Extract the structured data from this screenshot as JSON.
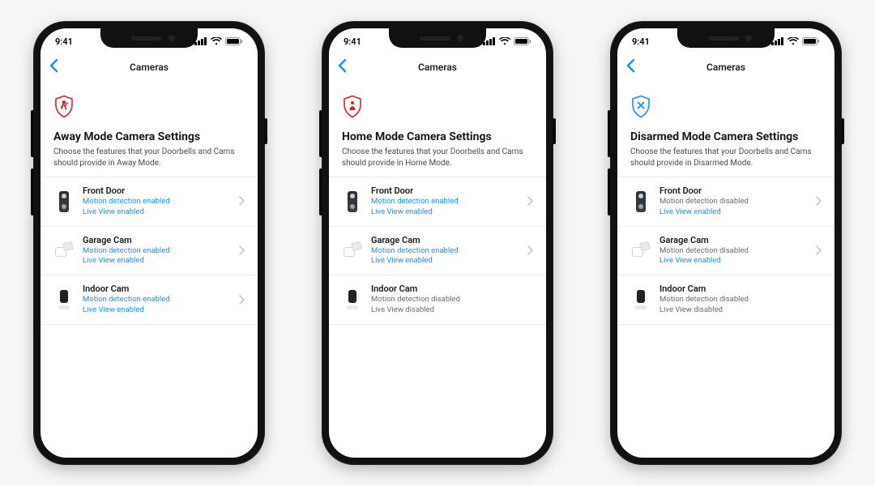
{
  "status": {
    "time": "9:41"
  },
  "nav": {
    "title": "Cameras"
  },
  "screens": [
    {
      "mode": "away",
      "title": "Away Mode Camera Settings",
      "subtitle": "Choose the features that your Doorbells and Cams should provide in Away Mode.",
      "devices": [
        {
          "name": "Front Door",
          "thumb": "doorbell",
          "motion": "Motion detection enabled",
          "motion_state": "enabled",
          "live": "Live View enabled",
          "live_state": "enabled",
          "chevron": true
        },
        {
          "name": "Garage Cam",
          "thumb": "spotlight",
          "motion": "Motion detection enabled",
          "motion_state": "enabled",
          "live": "Live View enabled",
          "live_state": "enabled",
          "chevron": true
        },
        {
          "name": "Indoor Cam",
          "thumb": "indoor",
          "motion": "Motion detection enabled",
          "motion_state": "enabled",
          "live": "Live View enabled",
          "live_state": "enabled",
          "chevron": true
        }
      ]
    },
    {
      "mode": "home",
      "title": "Home Mode Camera Settings",
      "subtitle": "Choose the features that your Doorbells and Cams should provide in Home Mode.",
      "devices": [
        {
          "name": "Front Door",
          "thumb": "doorbell",
          "motion": "Motion detection enabled",
          "motion_state": "enabled",
          "live": "Live View enabled",
          "live_state": "enabled",
          "chevron": true
        },
        {
          "name": "Garage Cam",
          "thumb": "spotlight",
          "motion": "Motion detection enabled",
          "motion_state": "enabled",
          "live": "Live View enabled",
          "live_state": "enabled",
          "chevron": true
        },
        {
          "name": "Indoor Cam",
          "thumb": "indoor",
          "motion": "Motion detection disabled",
          "motion_state": "disabled",
          "live": "Live View disabled",
          "live_state": "disabled",
          "chevron": false
        }
      ]
    },
    {
      "mode": "disarmed",
      "title": "Disarmed Mode Camera Settings",
      "subtitle": "Choose the features that your Doorbells and Cams should provide in Disarmed Mode.",
      "devices": [
        {
          "name": "Front Door",
          "thumb": "doorbell",
          "motion": "Motion detection disabled",
          "motion_state": "disabled",
          "live": "Live View enabled",
          "live_state": "enabled",
          "chevron": true
        },
        {
          "name": "Garage Cam",
          "thumb": "spotlight",
          "motion": "Motion detection disabled",
          "motion_state": "disabled",
          "live": "Live View enabled",
          "live_state": "enabled",
          "chevron": true
        },
        {
          "name": "Indoor Cam",
          "thumb": "indoor",
          "motion": "Motion detection disabled",
          "motion_state": "disabled",
          "live": "Live View disabled",
          "live_state": "disabled",
          "chevron": false
        }
      ]
    }
  ],
  "colors": {
    "away": "#d8232a",
    "home": "#d8232a",
    "disarmed": "#1f8ded"
  }
}
